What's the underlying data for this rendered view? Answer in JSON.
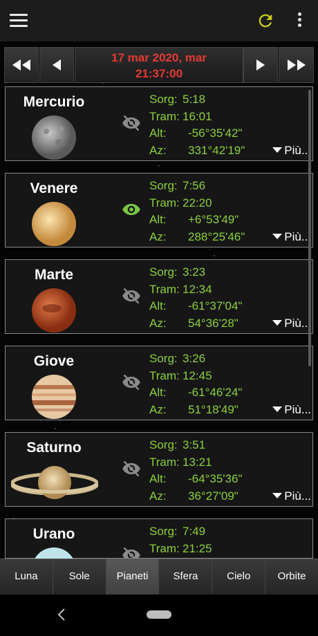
{
  "date": {
    "line1": "17 mar 2020,  mar",
    "line2": "21:37:00"
  },
  "planets": [
    {
      "name": "Mercurio",
      "visible": false,
      "rows": [
        [
          "Sorg:",
          "5:18"
        ],
        [
          "Tram:",
          "16:01"
        ],
        [
          "Alt:",
          "-56°35'42\""
        ],
        [
          "Az:",
          "331°42'19\""
        ]
      ],
      "more": "Più..."
    },
    {
      "name": "Venere",
      "visible": true,
      "rows": [
        [
          "Sorg:",
          "7:56"
        ],
        [
          "Tram:",
          "22:20"
        ],
        [
          "Alt:",
          "+6°53'49\""
        ],
        [
          "Az:",
          "288°25'46\""
        ]
      ],
      "more": "Più..."
    },
    {
      "name": "Marte",
      "visible": false,
      "rows": [
        [
          "Sorg:",
          "3:23"
        ],
        [
          "Tram:",
          "12:34"
        ],
        [
          "Alt:",
          "-61°37'04\""
        ],
        [
          "Az:",
          "54°36'28\""
        ]
      ],
      "more": "Più..."
    },
    {
      "name": "Giove",
      "visible": false,
      "rows": [
        [
          "Sorg:",
          "3:26"
        ],
        [
          "Tram:",
          "12:45"
        ],
        [
          "Alt:",
          "-61°46'24\""
        ],
        [
          "Az:",
          "51°18'49\""
        ]
      ],
      "more": "Più..."
    },
    {
      "name": "Saturno",
      "visible": false,
      "rows": [
        [
          "Sorg:",
          "3:51"
        ],
        [
          "Tram:",
          "13:21"
        ],
        [
          "Alt:",
          "-64°35'36\""
        ],
        [
          "Az:",
          "36°27'09\""
        ]
      ],
      "more": "Più..."
    },
    {
      "name": "Urano",
      "visible": false,
      "rows": [
        [
          "Sorg:",
          "7:49"
        ],
        [
          "Tram:",
          "21:25"
        ]
      ],
      "more": ""
    }
  ],
  "tabs": [
    "Luna",
    "Sole",
    "Pianeti",
    "Sfera",
    "Cielo",
    "Orbite"
  ],
  "active_tab": "Pianeti",
  "colors": {
    "accent_date": "#e53935",
    "values_green": "#8bd13b",
    "refresh_yellow": "#c8c81e",
    "eye_visible": "#7cc544",
    "eye_hidden": "#8a8a8a"
  }
}
